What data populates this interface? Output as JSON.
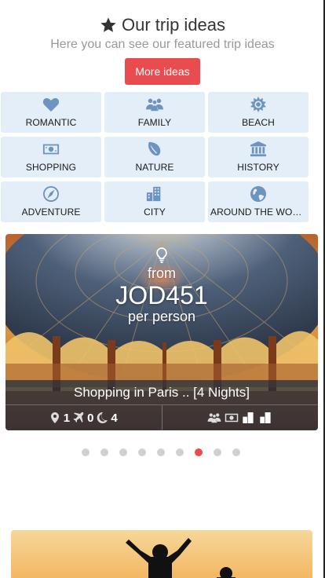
{
  "header": {
    "title": "Our trip ideas",
    "subtitle": "Here you can see our featured trip ideas",
    "more_button": "More ideas",
    "title_icon": "star-icon"
  },
  "categories": [
    {
      "label": "ROMANTIC",
      "icon": "heart-icon"
    },
    {
      "label": "FAMILY",
      "icon": "family-icon"
    },
    {
      "label": "BEACH",
      "icon": "sun-icon"
    },
    {
      "label": "SHOPPING",
      "icon": "money-icon"
    },
    {
      "label": "NATURE",
      "icon": "leaf-icon"
    },
    {
      "label": "HISTORY",
      "icon": "museum-icon"
    },
    {
      "label": "ADVENTURE",
      "icon": "compass-icon"
    },
    {
      "label": "CITY",
      "icon": "building-icon"
    },
    {
      "label": "AROUND THE WORLD",
      "icon": "globe-icon"
    }
  ],
  "featured_trip": {
    "price_prefix": "from",
    "price": "JOD451",
    "price_suffix": "per person",
    "title": "Shopping in Paris .. [4 Nights]",
    "destinations": "1",
    "flights": "0",
    "nights": "4",
    "image": "paris-department-store-dome"
  },
  "carousel": {
    "total": 9,
    "active_index": 6
  },
  "colors": {
    "accent": "#e84c4f",
    "tile_bg": "#e3eef8",
    "tile_icon": "#6d93bf"
  }
}
